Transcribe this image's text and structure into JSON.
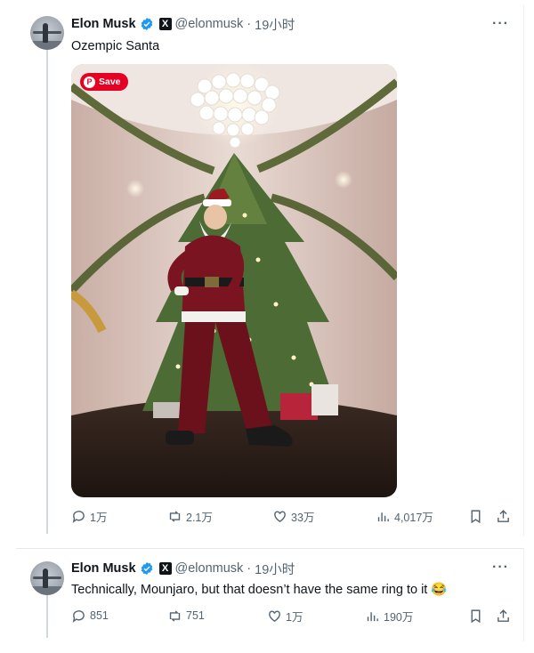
{
  "colors": {
    "accent": "#1d9bf0",
    "text": "#0f1419",
    "muted": "#536471",
    "pinterest": "#e60023"
  },
  "tweets": [
    {
      "author": {
        "name": "Elon Musk",
        "handle": "@elonmusk",
        "verified": true,
        "affiliate_icon": "x-logo-icon"
      },
      "time": "19小时",
      "text": "Ozempic Santa",
      "media": {
        "save_label": "Save",
        "description_icon": "photo-santa-christmas-tree"
      },
      "stats": {
        "replies": "1万",
        "reposts": "2.1万",
        "likes": "33万",
        "views": "4,017万"
      }
    },
    {
      "author": {
        "name": "Elon Musk",
        "handle": "@elonmusk",
        "verified": true,
        "affiliate_icon": "x-logo-icon"
      },
      "time": "19小时",
      "text": "Technically, Mounjaro, but that doesn’t have the same ring to it 😂",
      "stats": {
        "replies": "851",
        "reposts": "751",
        "likes": "1万",
        "views": "190万"
      }
    }
  ],
  "separator": "·",
  "more_glyph": "···"
}
